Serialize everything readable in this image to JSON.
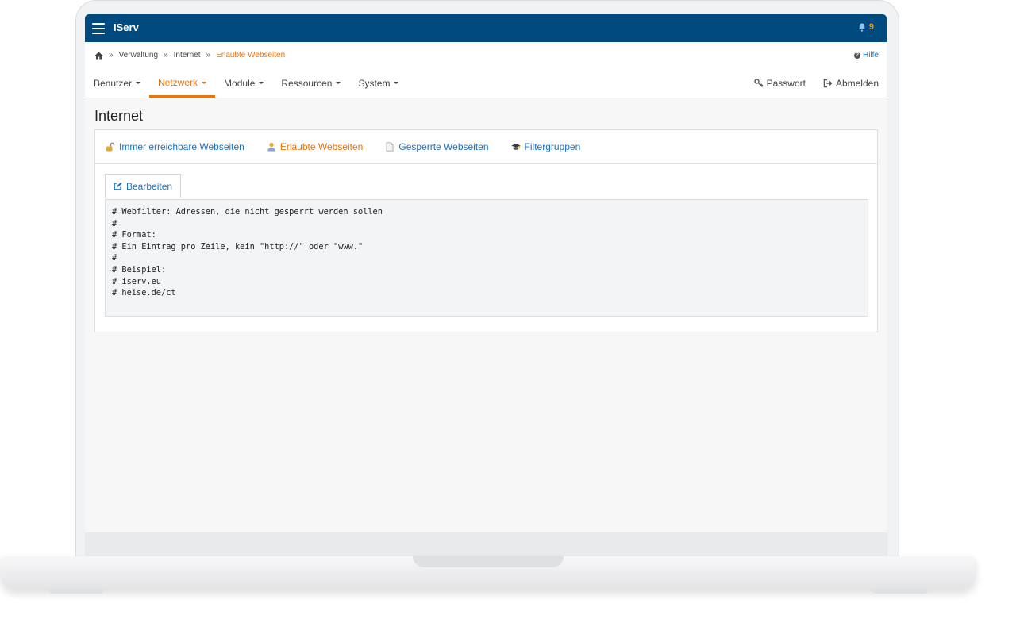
{
  "app": {
    "title": "IServ",
    "notification_count": "9"
  },
  "breadcrumb": {
    "items": [
      "Verwaltung",
      "Internet"
    ],
    "active": "Erlaubte Webseiten",
    "separator": "»"
  },
  "help": {
    "label": "Hilfe"
  },
  "nav": {
    "items": [
      {
        "label": "Benutzer"
      },
      {
        "label": "Netzwerk"
      },
      {
        "label": "Module"
      },
      {
        "label": "Ressourcen"
      },
      {
        "label": "System"
      }
    ],
    "active_index": 1,
    "password_label": "Passwort",
    "logout_label": "Abmelden"
  },
  "page": {
    "title": "Internet"
  },
  "tabs": [
    {
      "label": "Immer erreichbare Webseiten",
      "icon": "unlock-icon"
    },
    {
      "label": "Erlaubte Webseiten",
      "icon": "user-icon"
    },
    {
      "label": "Gesperrte Webseiten",
      "icon": "document-icon"
    },
    {
      "label": "Filtergruppen",
      "icon": "graduation-cap-icon"
    }
  ],
  "edit_button": {
    "label": "Bearbeiten"
  },
  "code_lines": "# Webfilter: Adressen, die nicht gesperrt werden sollen\n#\n# Format:\n# Ein Eintrag pro Zeile, kein \"http://\" oder \"www.\"\n#\n# Beispiel:\n# iserv.eu\n# heise.de/ct",
  "colors": {
    "topbar": "#004a80",
    "accent": "#e8740c",
    "link": "#1a73c4"
  }
}
